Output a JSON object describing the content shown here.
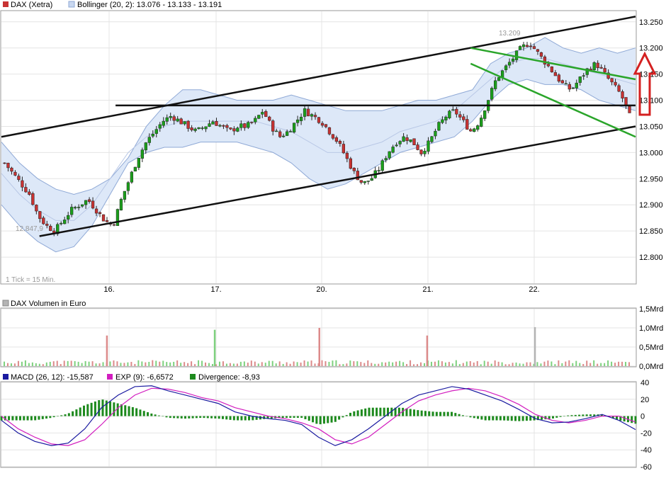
{
  "legend": {
    "price_label": "DAX (Xetra)",
    "bollinger_label": "Bollinger (20, 2): 13.076 - 13.133 - 13.191",
    "volume_label": "DAX Volumen in Euro",
    "macd_label": "MACD (26, 12): -15,587",
    "exp_label": "EXP (9): -6,6572",
    "divergence_label": "Divergence: -8,93"
  },
  "annotations": {
    "high_label": "13.209",
    "low_label": "12.847,9",
    "tick_info": "1 Tick = 15 Min."
  },
  "colors": {
    "up": "#1ba01b",
    "down": "#c83232",
    "band_fill": "#dde8f8",
    "band_line": "#8fa9d6",
    "trend_green": "#2aa52a",
    "arrow": "#d42020",
    "macd": "#1a1aa0",
    "signal": "#d21dbf",
    "volume_up": "#7ed17e",
    "volume_down": "#dc8a8a",
    "volume_neutral": "#b4b4b4",
    "divergence": "#1d8a1d"
  },
  "chart_data": [
    {
      "type": "line",
      "subtype": "candlestick",
      "title": "DAX (Xetra)",
      "interval": "15 min",
      "x_tick_labels": [
        "16.",
        "17.",
        "20.",
        "21.",
        "22."
      ],
      "y_tick_labels": [
        "13.250",
        "13.200",
        "13.150",
        "13.100",
        "13.050",
        "13.000",
        "12.950",
        "12.900",
        "12.850",
        "12.800"
      ],
      "ylim": [
        12.75,
        13.27
      ],
      "grid": true,
      "high_marker": 13.209,
      "low_marker": 12.8479,
      "series": [
        {
          "name": "DAX (Xetra)",
          "close_path": [
            12.98,
            12.96,
            12.94,
            12.92,
            12.88,
            12.86,
            12.85,
            12.87,
            12.89,
            12.9,
            12.91,
            12.89,
            12.87,
            12.86,
            12.91,
            12.95,
            12.99,
            13.02,
            13.04,
            13.06,
            13.07,
            13.06,
            13.05,
            13.04,
            13.05,
            13.06,
            13.05,
            13.04,
            13.05,
            13.05,
            13.06,
            13.08,
            13.05,
            13.03,
            13.04,
            13.06,
            13.08,
            13.07,
            13.06,
            13.04,
            13.02,
            12.99,
            12.96,
            12.94,
            12.95,
            12.97,
            13.0,
            13.02,
            13.03,
            13.02,
            13.0,
            13.02,
            13.05,
            13.07,
            13.08,
            13.06,
            13.04,
            13.06,
            13.1,
            13.14,
            13.16,
            13.18,
            13.2,
            13.21,
            13.19,
            13.17,
            13.15,
            13.13,
            13.12,
            13.14,
            13.16,
            13.17,
            13.15,
            13.13,
            13.11,
            13.07
          ]
        },
        {
          "name": "Bollinger upper",
          "values": [
            13.02,
            12.98,
            12.95,
            12.93,
            12.92,
            12.93,
            12.95,
            12.99,
            13.05,
            13.09,
            13.12,
            13.12,
            13.11,
            13.1,
            13.1,
            13.1,
            13.11,
            13.1,
            13.09,
            13.08,
            13.08,
            13.08,
            13.09,
            13.1,
            13.1,
            13.11,
            13.12,
            13.17,
            13.19,
            13.2,
            13.22,
            13.2,
            13.19,
            13.2,
            13.19,
            13.2
          ]
        },
        {
          "name": "Bollinger middle",
          "values": [
            12.96,
            12.92,
            12.89,
            12.87,
            12.87,
            12.9,
            12.95,
            13.0,
            13.03,
            13.05,
            13.06,
            13.06,
            13.06,
            13.06,
            13.06,
            13.05,
            13.04,
            13.02,
            13.0,
            13.0,
            13.01,
            13.02,
            13.04,
            13.05,
            13.06,
            13.08,
            13.11,
            13.14,
            13.17,
            13.18,
            13.18,
            13.17,
            13.16,
            13.15,
            13.14,
            13.13
          ]
        },
        {
          "name": "Bollinger lower",
          "values": [
            12.9,
            12.86,
            12.83,
            12.81,
            12.82,
            12.86,
            12.92,
            12.98,
            13.0,
            13.01,
            13.01,
            13.02,
            13.02,
            13.02,
            13.01,
            13.0,
            12.98,
            12.95,
            12.93,
            12.94,
            12.96,
            12.98,
            13.0,
            13.01,
            13.02,
            13.03,
            13.06,
            13.1,
            13.13,
            13.14,
            13.13,
            13.13,
            13.12,
            13.1,
            13.09,
            13.08
          ]
        }
      ],
      "trend_lines": [
        {
          "name": "upper channel",
          "from": [
            0,
            13.03
          ],
          "to": [
            1,
            13.26
          ]
        },
        {
          "name": "lower channel",
          "from": [
            0.06,
            12.84
          ],
          "to": [
            1,
            13.05
          ]
        },
        {
          "name": "horizontal resistance",
          "from": [
            0.18,
            13.09
          ],
          "to": [
            1,
            13.09
          ]
        },
        {
          "name": "green upper",
          "from": [
            0.74,
            13.2
          ],
          "to": [
            1,
            13.14
          ]
        },
        {
          "name": "green lower",
          "from": [
            0.74,
            13.17
          ],
          "to": [
            1,
            13.03
          ]
        }
      ]
    },
    {
      "type": "bar",
      "title": "DAX Volumen in Euro",
      "x_tick_labels": [
        "16.",
        "17.",
        "20.",
        "21.",
        "22."
      ],
      "y_tick_labels": [
        "1,5Mrd",
        "1,0Mrd",
        "0,5Mrd",
        "0,0Mrd"
      ],
      "ylim": [
        0,
        1.5
      ],
      "units": "Mrd",
      "spikes": [
        {
          "position": 0.165,
          "value": 0.8,
          "direction": "down"
        },
        {
          "position": 0.335,
          "value": 0.95,
          "direction": "up"
        },
        {
          "position": 0.5,
          "value": 1.0,
          "direction": "down"
        },
        {
          "position": 0.67,
          "value": 0.8,
          "direction": "down"
        },
        {
          "position": 0.84,
          "value": 1.02,
          "direction": "neutral"
        }
      ],
      "baseline_value": 0.12
    },
    {
      "type": "line",
      "title": "MACD",
      "x_tick_labels": [
        "16.",
        "17.",
        "20.",
        "21.",
        "22."
      ],
      "y_tick_labels": [
        "40",
        "20",
        "0",
        "-20",
        "-40",
        "-60"
      ],
      "ylim": [
        -60,
        40
      ],
      "series": [
        {
          "name": "MACD (26, 12)",
          "values": [
            -5,
            -20,
            -30,
            -35,
            -32,
            -15,
            10,
            25,
            35,
            36,
            30,
            25,
            20,
            15,
            5,
            0,
            -3,
            -5,
            -10,
            -25,
            -35,
            -28,
            -15,
            0,
            15,
            25,
            30,
            35,
            32,
            25,
            18,
            8,
            -3,
            -8,
            -7,
            -3,
            2,
            -5,
            -16
          ]
        },
        {
          "name": "EXP (9)",
          "values": [
            0,
            -15,
            -25,
            -33,
            -35,
            -28,
            -10,
            10,
            25,
            33,
            32,
            28,
            22,
            18,
            10,
            5,
            0,
            -3,
            -8,
            -15,
            -28,
            -33,
            -25,
            -10,
            5,
            18,
            25,
            30,
            33,
            30,
            23,
            14,
            2,
            -5,
            -8,
            -5,
            0,
            0,
            -7
          ]
        },
        {
          "name": "Divergence",
          "values": [
            -5,
            -5,
            -5,
            -2,
            3,
            13,
            20,
            15,
            10,
            3,
            -2,
            -3,
            -2,
            -3,
            -5,
            -5,
            -3,
            -2,
            -2,
            -10,
            -7,
            5,
            10,
            10,
            10,
            7,
            5,
            5,
            -1,
            -5,
            -5,
            -6,
            -5,
            -3,
            1,
            2,
            2,
            -5,
            -9
          ]
        }
      ]
    }
  ]
}
